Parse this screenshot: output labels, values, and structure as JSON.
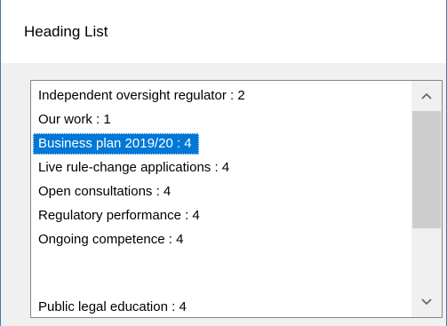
{
  "dialog": {
    "title": "Heading List"
  },
  "list": {
    "items": [
      {
        "label": "Independent oversight regulator : 2",
        "selected": false
      },
      {
        "label": "Our work : 1",
        "selected": false
      },
      {
        "label": "Business plan 2019/20 : 4",
        "selected": true
      },
      {
        "label": "Live rule-change applications : 4",
        "selected": false
      },
      {
        "label": "Open consultations : 4",
        "selected": false
      },
      {
        "label": "Regulatory performance : 4",
        "selected": false
      },
      {
        "label": "Ongoing competence : 4",
        "selected": false
      },
      {
        "label": "Public legal education : 4",
        "selected": false
      }
    ],
    "selected_color": "#0078d7"
  },
  "scrollbar": {
    "up_icon": "chevron-up-icon",
    "down_icon": "chevron-down-icon",
    "scroll_fraction": 0.0
  }
}
